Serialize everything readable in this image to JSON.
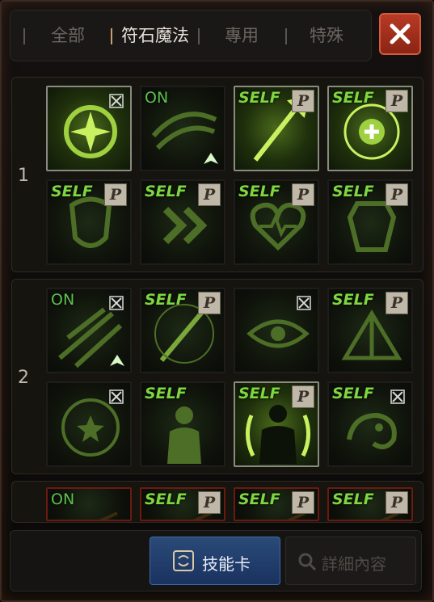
{
  "tabs": [
    {
      "label": "全部",
      "active": false
    },
    {
      "label": "符石魔法",
      "active": true
    },
    {
      "label": "專用",
      "active": false
    },
    {
      "label": "特殊",
      "active": false
    }
  ],
  "close_icon": "close-x-icon",
  "groups": [
    {
      "number": "1",
      "slots": [
        {
          "icon": "burst-orb-icon",
          "tag": "",
          "badge": "lock",
          "lit": true
        },
        {
          "icon": "swirl-slash-icon",
          "tag": "ON",
          "badge": "upgrade",
          "lit": false
        },
        {
          "icon": "spear-icon",
          "tag": "SELF",
          "badge": "P",
          "lit": true
        },
        {
          "icon": "holy-circle-icon",
          "tag": "SELF",
          "badge": "P",
          "lit": true
        },
        {
          "icon": "rune-shield-icon",
          "tag": "SELF",
          "badge": "P",
          "lit": false
        },
        {
          "icon": "speed-chevrons-icon",
          "tag": "SELF",
          "badge": "P",
          "lit": false
        },
        {
          "icon": "heart-pulse-icon",
          "tag": "SELF",
          "badge": "P",
          "lit": false
        },
        {
          "icon": "armor-icon",
          "tag": "SELF",
          "badge": "P",
          "lit": false
        }
      ]
    },
    {
      "number": "2",
      "slots": [
        {
          "icon": "dash-strike-icon",
          "tag": "ON",
          "badge": "lock-upgrade",
          "lit": false
        },
        {
          "icon": "sword-slash-icon",
          "tag": "SELF",
          "badge": "P",
          "lit": false
        },
        {
          "icon": "eye-icon",
          "tag": "",
          "badge": "lock",
          "lit": false
        },
        {
          "icon": "tent-icon",
          "tag": "SELF",
          "badge": "P",
          "lit": false
        },
        {
          "icon": "star-rune-icon",
          "tag": "",
          "badge": "lock",
          "lit": false
        },
        {
          "icon": "silhouette-icon",
          "tag": "SELF",
          "badge": "",
          "lit": false
        },
        {
          "icon": "aura-body-icon",
          "tag": "SELF",
          "badge": "P",
          "lit": true
        },
        {
          "icon": "chameleon-icon",
          "tag": "SELF",
          "badge": "lock",
          "lit": false
        }
      ]
    },
    {
      "number": "",
      "slots": [
        {
          "icon": "partial-icon",
          "tag": "ON",
          "badge": "",
          "lit": false
        },
        {
          "icon": "partial-icon",
          "tag": "SELF",
          "badge": "P",
          "lit": false
        },
        {
          "icon": "partial-icon",
          "tag": "SELF",
          "badge": "P",
          "lit": false
        },
        {
          "icon": "partial-icon",
          "tag": "SELF",
          "badge": "P",
          "lit": false
        }
      ]
    }
  ],
  "buttons": {
    "skill_card": "技能卡",
    "detail": "詳細內容",
    "skill_card_icon": "card-swap-icon",
    "detail_icon": "magnifier-icon"
  },
  "colors": {
    "accent_green": "#7ed640",
    "close_red": "#b83a24",
    "button_blue": "#2a4a78"
  }
}
